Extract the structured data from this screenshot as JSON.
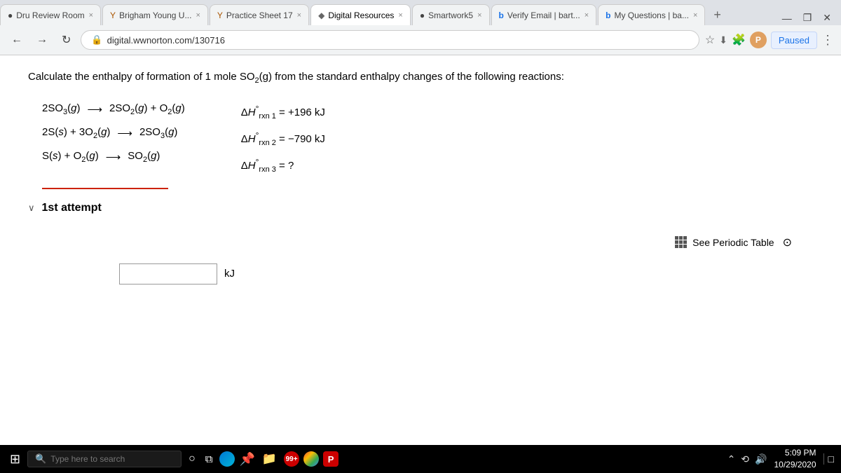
{
  "browser": {
    "tabs": [
      {
        "id": "tab1",
        "label": "Dru Review Room",
        "favicon": "●",
        "active": false,
        "closeable": true
      },
      {
        "id": "tab2",
        "label": "Brigham Young U...",
        "favicon": "Y",
        "active": false,
        "closeable": true
      },
      {
        "id": "tab3",
        "label": "Practice Sheet 17",
        "favicon": "Y",
        "active": false,
        "closeable": true
      },
      {
        "id": "tab4",
        "label": "Digital Resources",
        "favicon": "◆",
        "active": true,
        "closeable": true
      },
      {
        "id": "tab5",
        "label": "Smartwork5",
        "favicon": "●",
        "active": false,
        "closeable": true
      },
      {
        "id": "tab6",
        "label": "Verify Email | bart...",
        "favicon": "b",
        "active": false,
        "closeable": true
      },
      {
        "id": "tab7",
        "label": "My Questions | ba...",
        "favicon": "b",
        "active": false,
        "closeable": true
      }
    ],
    "url": "digital.wwnorton.com/130716",
    "paused_label": "Paused"
  },
  "question": {
    "text": "Calculate the enthalpy of formation of 1 mole SO₂(g) from the standard enthalpy changes of the following reactions:",
    "reactions": [
      {
        "reactants": "2SO₃(g)",
        "products": "2SO₂(g) + O₂(g)",
        "enthalpy_label": "ΔH°rxn 1 = +196 kJ"
      },
      {
        "reactants": "2S(s) + 3O₂(g)",
        "products": "2SO₃(g)",
        "enthalpy_label": "ΔH°rxn 2 = -790 kJ"
      },
      {
        "reactants": "S(s) + O₂(g)",
        "products": "SO₂(g)",
        "enthalpy_label": "ΔH°rxn 3 = ?"
      }
    ]
  },
  "attempt": {
    "label": "1st attempt"
  },
  "periodic_table": {
    "link_label": "See Periodic Table"
  },
  "answer": {
    "placeholder": "",
    "unit": "kJ"
  },
  "taskbar": {
    "search_placeholder": "Type here to search",
    "time": "5:09 PM",
    "date": "10/29/2020"
  }
}
